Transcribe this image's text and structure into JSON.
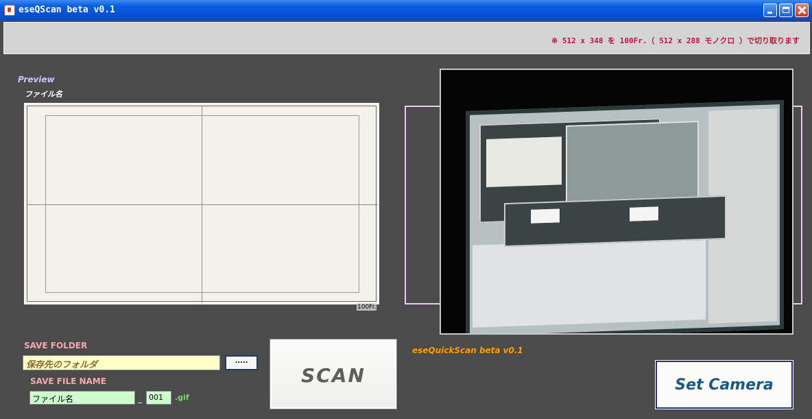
{
  "window": {
    "title": "eseQScan beta v0.1"
  },
  "info_bar": {
    "text": "※ 512 x 348 を 100Fr.（ 512 x 288 モノクロ ）で切り取ります"
  },
  "preview": {
    "label": "Preview",
    "filename_label": "ファイル名",
    "frame_count": "100Fr."
  },
  "camera": {
    "version_label": "eseQuickScan beta v0.1"
  },
  "save": {
    "folder_label": "SAVE FOLDER",
    "folder_value": "保存先のフォルダ",
    "browse_label": ".....",
    "file_name_label": "SAVE FILE NAME",
    "file_name_value": "ファイル名",
    "separator": "_",
    "number_value": "001",
    "extension": ".gif"
  },
  "buttons": {
    "scan": "SCAN",
    "set_camera": "Set Camera"
  },
  "colors": {
    "accent_info": "#c0153f",
    "preview_label": "#c8c6ff",
    "version": "#ff9a00",
    "save_labels": "#f6a7b0",
    "folder_field_bg": "#ffffc8",
    "name_field_bg": "#cdfdcd",
    "set_camera_text": "#1a5a82"
  }
}
